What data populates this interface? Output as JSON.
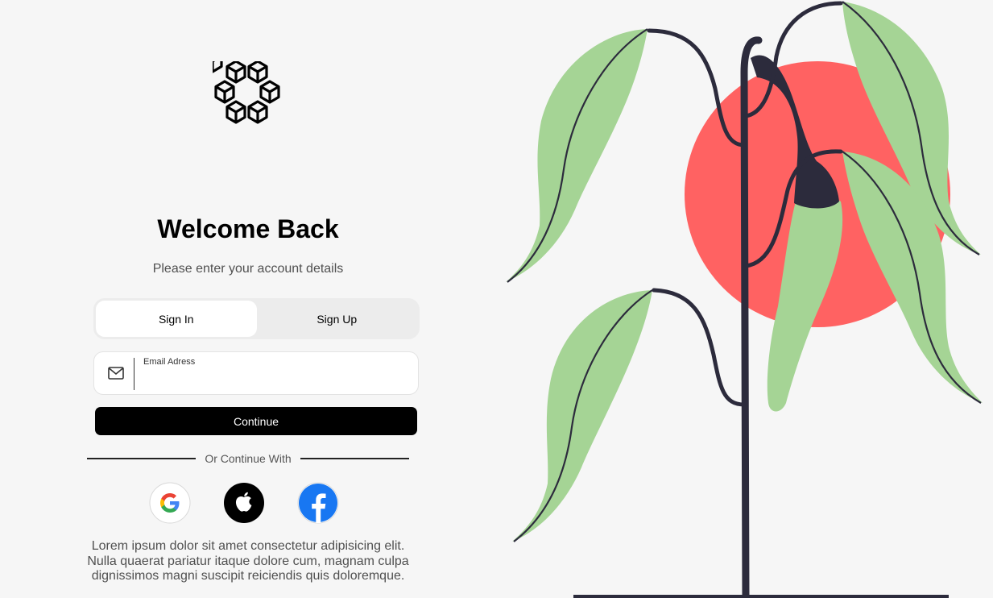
{
  "brand": {
    "logo_icon": "hexagon-cubes-logo"
  },
  "header": {
    "title": "Welcome Back",
    "subtitle": "Please enter your account details"
  },
  "tabs": [
    {
      "label": "Sign In",
      "active": true
    },
    {
      "label": "Sign Up",
      "active": false
    }
  ],
  "email_field": {
    "label": "Email Adress",
    "value": "",
    "placeholder": "",
    "icon": "mail-icon"
  },
  "continue_button": {
    "label": "Continue"
  },
  "divider": {
    "text": "Or Continue With"
  },
  "social_buttons": [
    {
      "provider": "google",
      "icon": "google-icon"
    },
    {
      "provider": "apple",
      "icon": "apple-icon"
    },
    {
      "provider": "facebook",
      "icon": "facebook-icon"
    }
  ],
  "footer": {
    "text": "Lorem ipsum dolor sit amet consectetur adipisicing elit. Nulla quaerat pariatur itaque dolore cum, magnam culpa dignissimos magni suscipit reiciendis quis doloremque."
  },
  "colors": {
    "primary": "#000000",
    "background": "#f6f6f6",
    "leaf": "#a5d495",
    "sun": "#ff6262",
    "stem": "#2c2b3c",
    "facebook": "#1877f2"
  }
}
